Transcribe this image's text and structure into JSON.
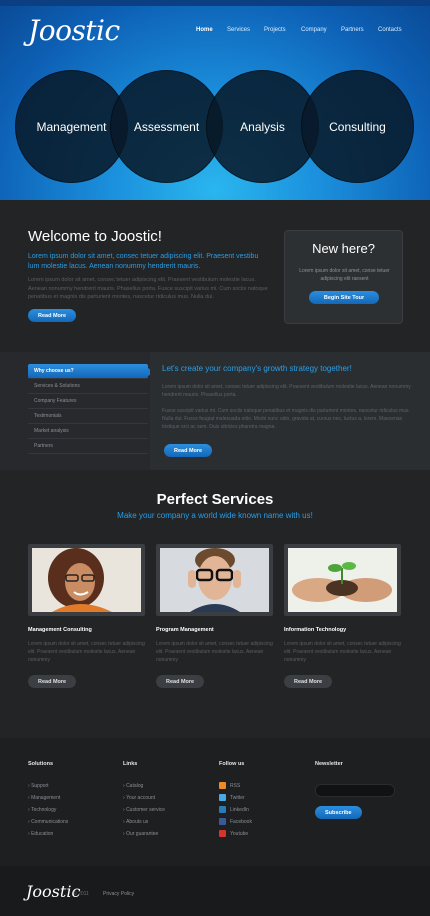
{
  "brand": {
    "logo": "Joostic",
    "accent": "#2a9ee6"
  },
  "nav": [
    "Home",
    "Services",
    "Projects",
    "Company",
    "Partners",
    "Contacts"
  ],
  "hero_circles": [
    "Management",
    "Assessment",
    "Analysis",
    "Consulting"
  ],
  "welcome": {
    "title": "Welcome to Joostic!",
    "lead": "Lorem ipsum dolor sit amet, consec tetuer adipiscing elit. Praesent vestibu lum molestie lacus. Aenean nonummy hendrerit mauris.",
    "text": "Lorem ipsum dolor sit amet, consec tetuer adipiscing elit. Praesent vestibulum molestie lacus. Aenean nonummy hendrerit mauris. Phasellus porta. Fusce suscipit varius mi. Cum sociis natoque penatibus et magnis dis parturient montes, nascetur ridiculus mus. Nulla dui.",
    "button": "Read More"
  },
  "new_here": {
    "title": "New here?",
    "text": "Lorem ipsum dolor sit amet, conse tetuer adipiscing elit raesent",
    "button": "Begin Site Tour"
  },
  "why_tabs": [
    "Why choose us?",
    "Services & Solutions",
    "Company Features",
    "Testimonials",
    "Market analysis",
    "Partners"
  ],
  "strategy": {
    "title": "Let's create your company's growth strategy together!",
    "p1": "Lorem ipsum dolor sit amet, consec tetuer adipiscing elit. Praesent vestibulum molestie lacus. Aenean nonummy hendrerit mauris. Phasellus porta.",
    "p2": "Fusce suscipit varius mi. Cum sociis natoque penatibus et magnis dis parturient montes, nascetur ridiculus mus. Nulla dui. Fusce feugiat malesuada odio. Morbi nunc odio, gravida at, cursus nec, luctus a, lorem. Maecenas tristique orci ac sem. Duis ultricies pharetra magna.",
    "button": "Read More"
  },
  "services": {
    "title": "Perfect Services",
    "subtitle": "Make your company a world wide known name with us!",
    "items": [
      {
        "title": "Management Consulting",
        "text": "Lorem ipsum dolor sit amet, consec tetuer adipiscing elit. Praesent vestibulum molestie lacus. Aenean nonummy",
        "button": "Read More"
      },
      {
        "title": "Program Management",
        "text": "Lorem ipsum dolor sit amet, consec tetuer adipiscing elit. Praesent vestibulum molestie lacus. Aenean nonummy",
        "button": "Read More"
      },
      {
        "title": "Information Technology",
        "text": "Lorem ipsum dolor sit amet, consec tetuer adipiscing elit. Praesent vestibulum molestie lacus. Aenean nonummy",
        "button": "Read More"
      }
    ]
  },
  "footer": {
    "solutions": {
      "title": "Solutions",
      "items": [
        "Support",
        "Management",
        "Technology",
        "Communications",
        "Education"
      ]
    },
    "links": {
      "title": "Links",
      "items": [
        "Catalog",
        "Your account",
        "Customer service",
        "Abouts us",
        "Our guarantee"
      ]
    },
    "follow": {
      "title": "Follow us",
      "items": [
        "RSS",
        "Twitter",
        "LinkedIn",
        "Facebook",
        "Youtube"
      ],
      "colors": [
        "#f08a24",
        "#4aa9e0",
        "#2a7ab8",
        "#3b5998",
        "#d6342c"
      ]
    },
    "newsletter": {
      "title": "Newsletter",
      "button": "Subscribe"
    }
  },
  "bottom": {
    "logo": "Joostic",
    "copyright": "© 2011",
    "privacy": "Privacy Policy"
  }
}
